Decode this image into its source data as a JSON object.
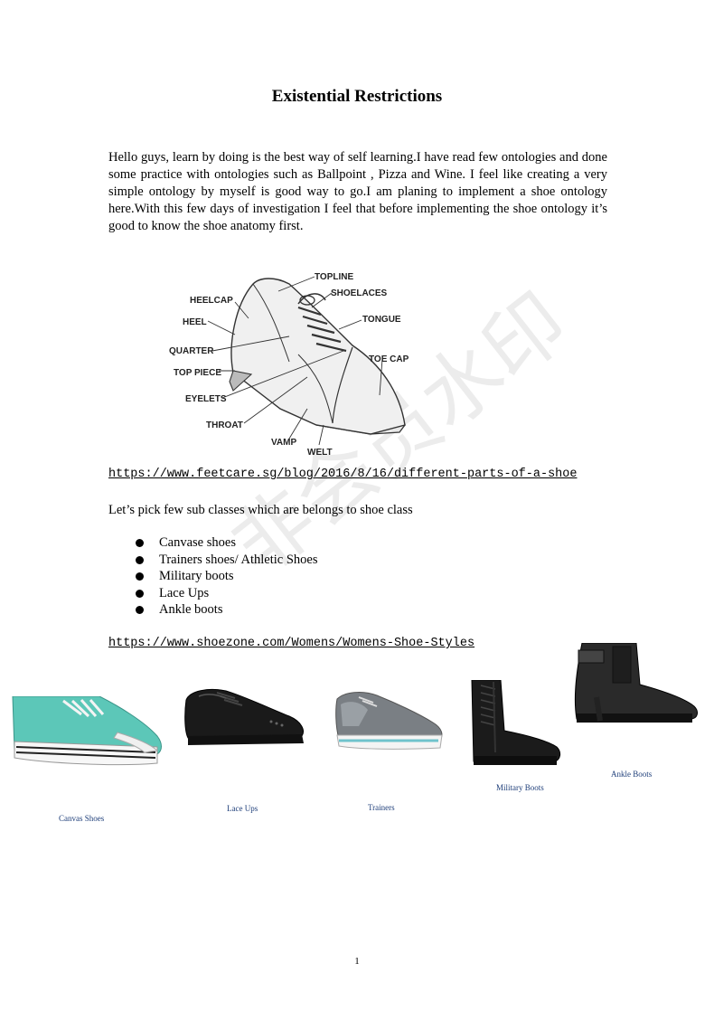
{
  "title": "Existential Restrictions",
  "intro": "Hello guys, learn by doing is the best way of self learning.I have read few ontologies and done some practice with ontologies such as Ballpoint , Pizza and Wine. I feel like creating a very simple ontology by myself is good way to go.I am planing to implement a shoe ontology here.With this few days of investigation I feel that before implementing the shoe ontology it’s good to know the shoe anatomy first.",
  "diagram_labels": {
    "topline": "TOPLINE",
    "shoelaces": "SHOELACES",
    "heelcap": "HEELCAP",
    "heel": "HEEL",
    "tongue": "TONGUE",
    "quarter": "QUARTER",
    "top_piece": "TOP PIECE",
    "toe_cap": "TOE CAP",
    "eyelets": "EYELETS",
    "throat": "THROAT",
    "vamp": "VAMP",
    "welt": "WELT"
  },
  "link1": "https://www.feetcare.sg/blog/2016/8/16/different-parts-of-a-shoe",
  "lead": "Let’s pick few sub classes which are belongs to shoe class",
  "bullets": [
    "Canvase shoes",
    "Trainers shoes/ Athletic Shoes",
    "Military boots",
    "Lace Ups",
    "Ankle boots"
  ],
  "link2": "https://www.shoezone.com/Womens/Womens-Shoe-Styles",
  "captions": {
    "canvas": "Canvas Shoes",
    "laceups": "Lace Ups",
    "trainers": "Trainers",
    "military": "Military Boots",
    "ankle": "Ankle Boots"
  },
  "watermark": "非会员水印",
  "page_number": "1"
}
